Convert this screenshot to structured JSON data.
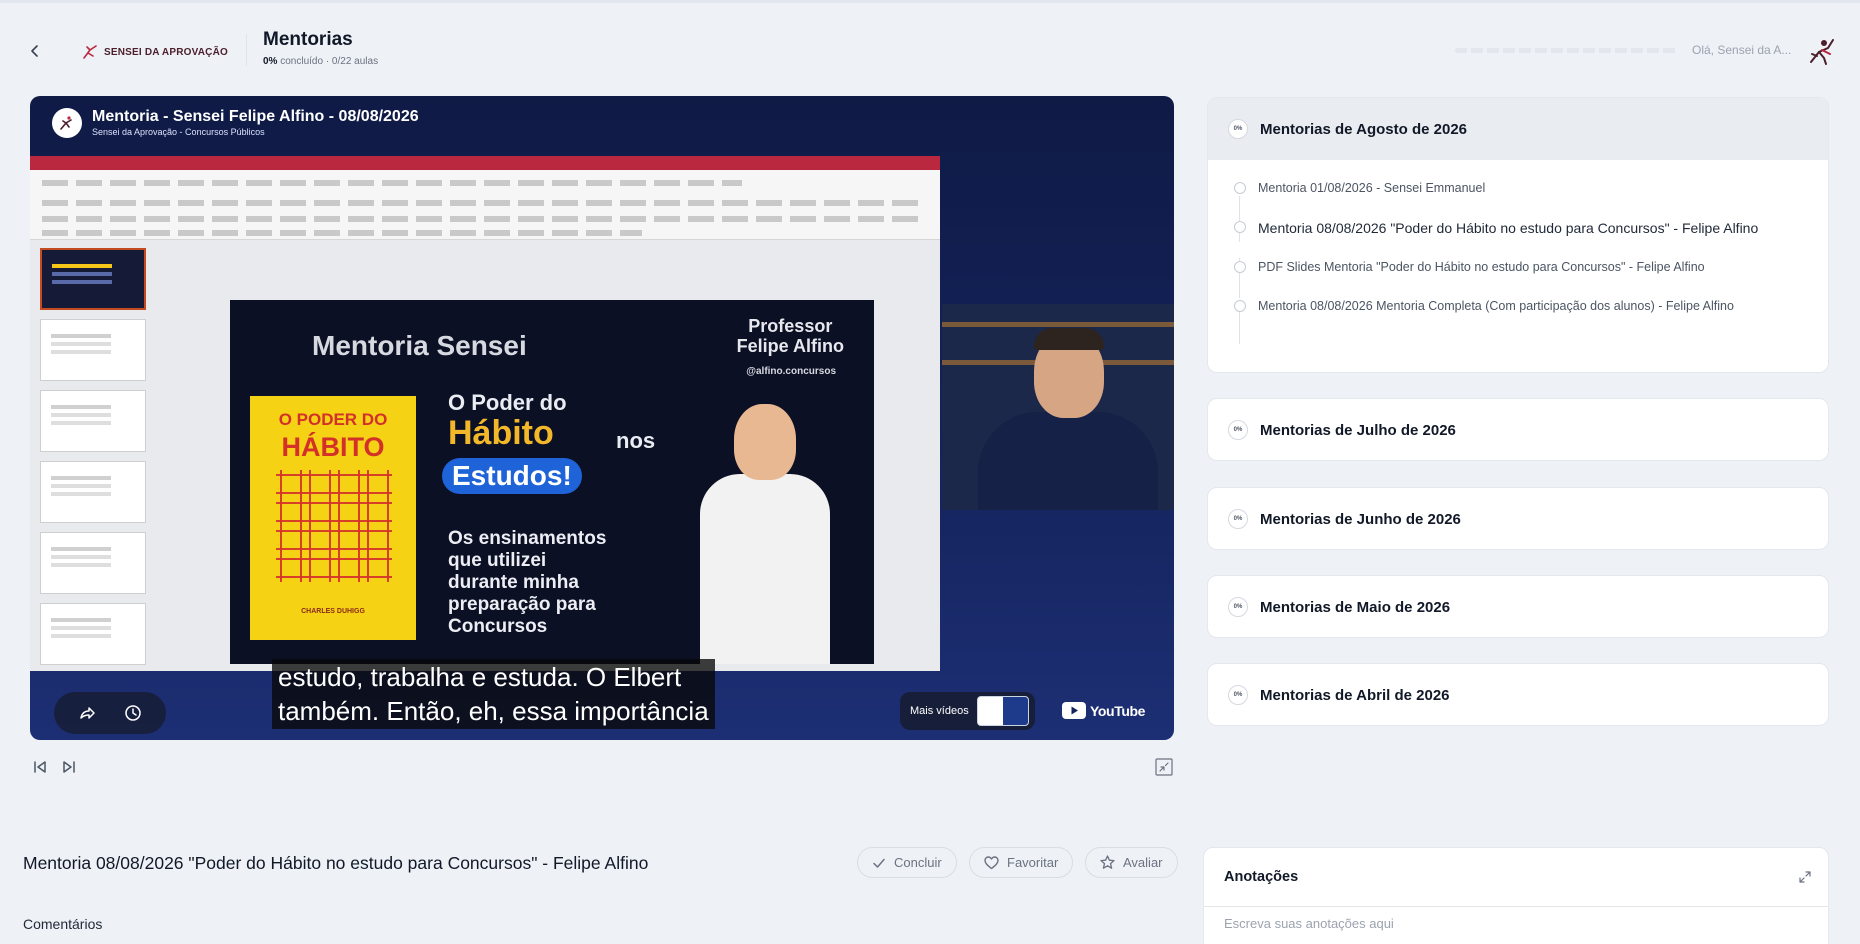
{
  "header": {
    "logo_text": "SENSEI DA APROVAÇÃO",
    "title": "Mentorias",
    "progress_percent": "0%",
    "progress_rest": " concluído · 0/22 aulas",
    "greeting": "Olá, Sensei da A..."
  },
  "video": {
    "title": "Mentoria - Sensei Felipe Alfino - 08/08/2026",
    "channel": "Sensei da Aprovação - Concursos Públicos",
    "slide": {
      "heading": "Mentoria Sensei",
      "professor_line1": "Professor",
      "professor_line2": "Felipe Alfino",
      "handle": "@alfino.concursos",
      "book_line1": "O PODER DO",
      "book_line2": "HÁBITO",
      "book_author": "CHARLES DUHIGG",
      "line1": "O Poder do",
      "line2": "Hábito",
      "line2_suffix": "nos",
      "badge": "Estudos!",
      "body1": "Os ensinamentos",
      "body2": "que utilizei",
      "body3": "durante minha",
      "body4": "preparação para",
      "body5": "Concursos"
    },
    "caption_line1": "estudo, trabalha e estuda. O Elbert",
    "caption_line2": "também. Então, eh, essa importância",
    "more_videos_label": "Mais vídeos",
    "youtube_label": "YouTube"
  },
  "sections": [
    {
      "title": "Mentorias de Agosto de 2026",
      "percent": "0%",
      "lessons": [
        {
          "title": "Mentoria 01/08/2026 - Sensei Emmanuel"
        },
        {
          "title": "Mentoria 08/08/2026 \"Poder do Hábito no estudo para Concursos\" - Felipe Alfino"
        },
        {
          "title": "PDF Slides Mentoria \"Poder do Hábito no estudo para Concursos\" - Felipe Alfino"
        },
        {
          "title": "Mentoria 08/08/2026 Mentoria Completa (Com participação dos alunos) - Felipe Alfino"
        }
      ]
    },
    {
      "title": "Mentorias de Julho de 2026",
      "percent": "0%"
    },
    {
      "title": "Mentorias de Junho de 2026",
      "percent": "0%"
    },
    {
      "title": "Mentorias de Maio de 2026",
      "percent": "0%"
    },
    {
      "title": "Mentorias de Abril de 2026",
      "percent": "0%"
    }
  ],
  "lesson": {
    "title": "Mentoria 08/08/2026 \"Poder do Hábito no estudo para Concursos\" - Felipe Alfino",
    "complete_label": "Concluir",
    "favorite_label": "Favoritar",
    "rate_label": "Avaliar",
    "comments_label": "Comentários"
  },
  "notes": {
    "title": "Anotações",
    "placeholder": "Escreva suas anotações aqui"
  },
  "colors": {
    "background": "#eef1f6",
    "video_bg": "#14235c",
    "brand": "#4b1e2a",
    "accent_red": "#b9283e"
  },
  "icons": [
    "back-icon",
    "logo-icon",
    "user-avatar-icon",
    "share-icon",
    "clock-icon",
    "youtube-icon",
    "previous-icon",
    "next-icon",
    "minimize-icon",
    "check-icon",
    "heart-icon",
    "star-icon",
    "expand-icon"
  ]
}
